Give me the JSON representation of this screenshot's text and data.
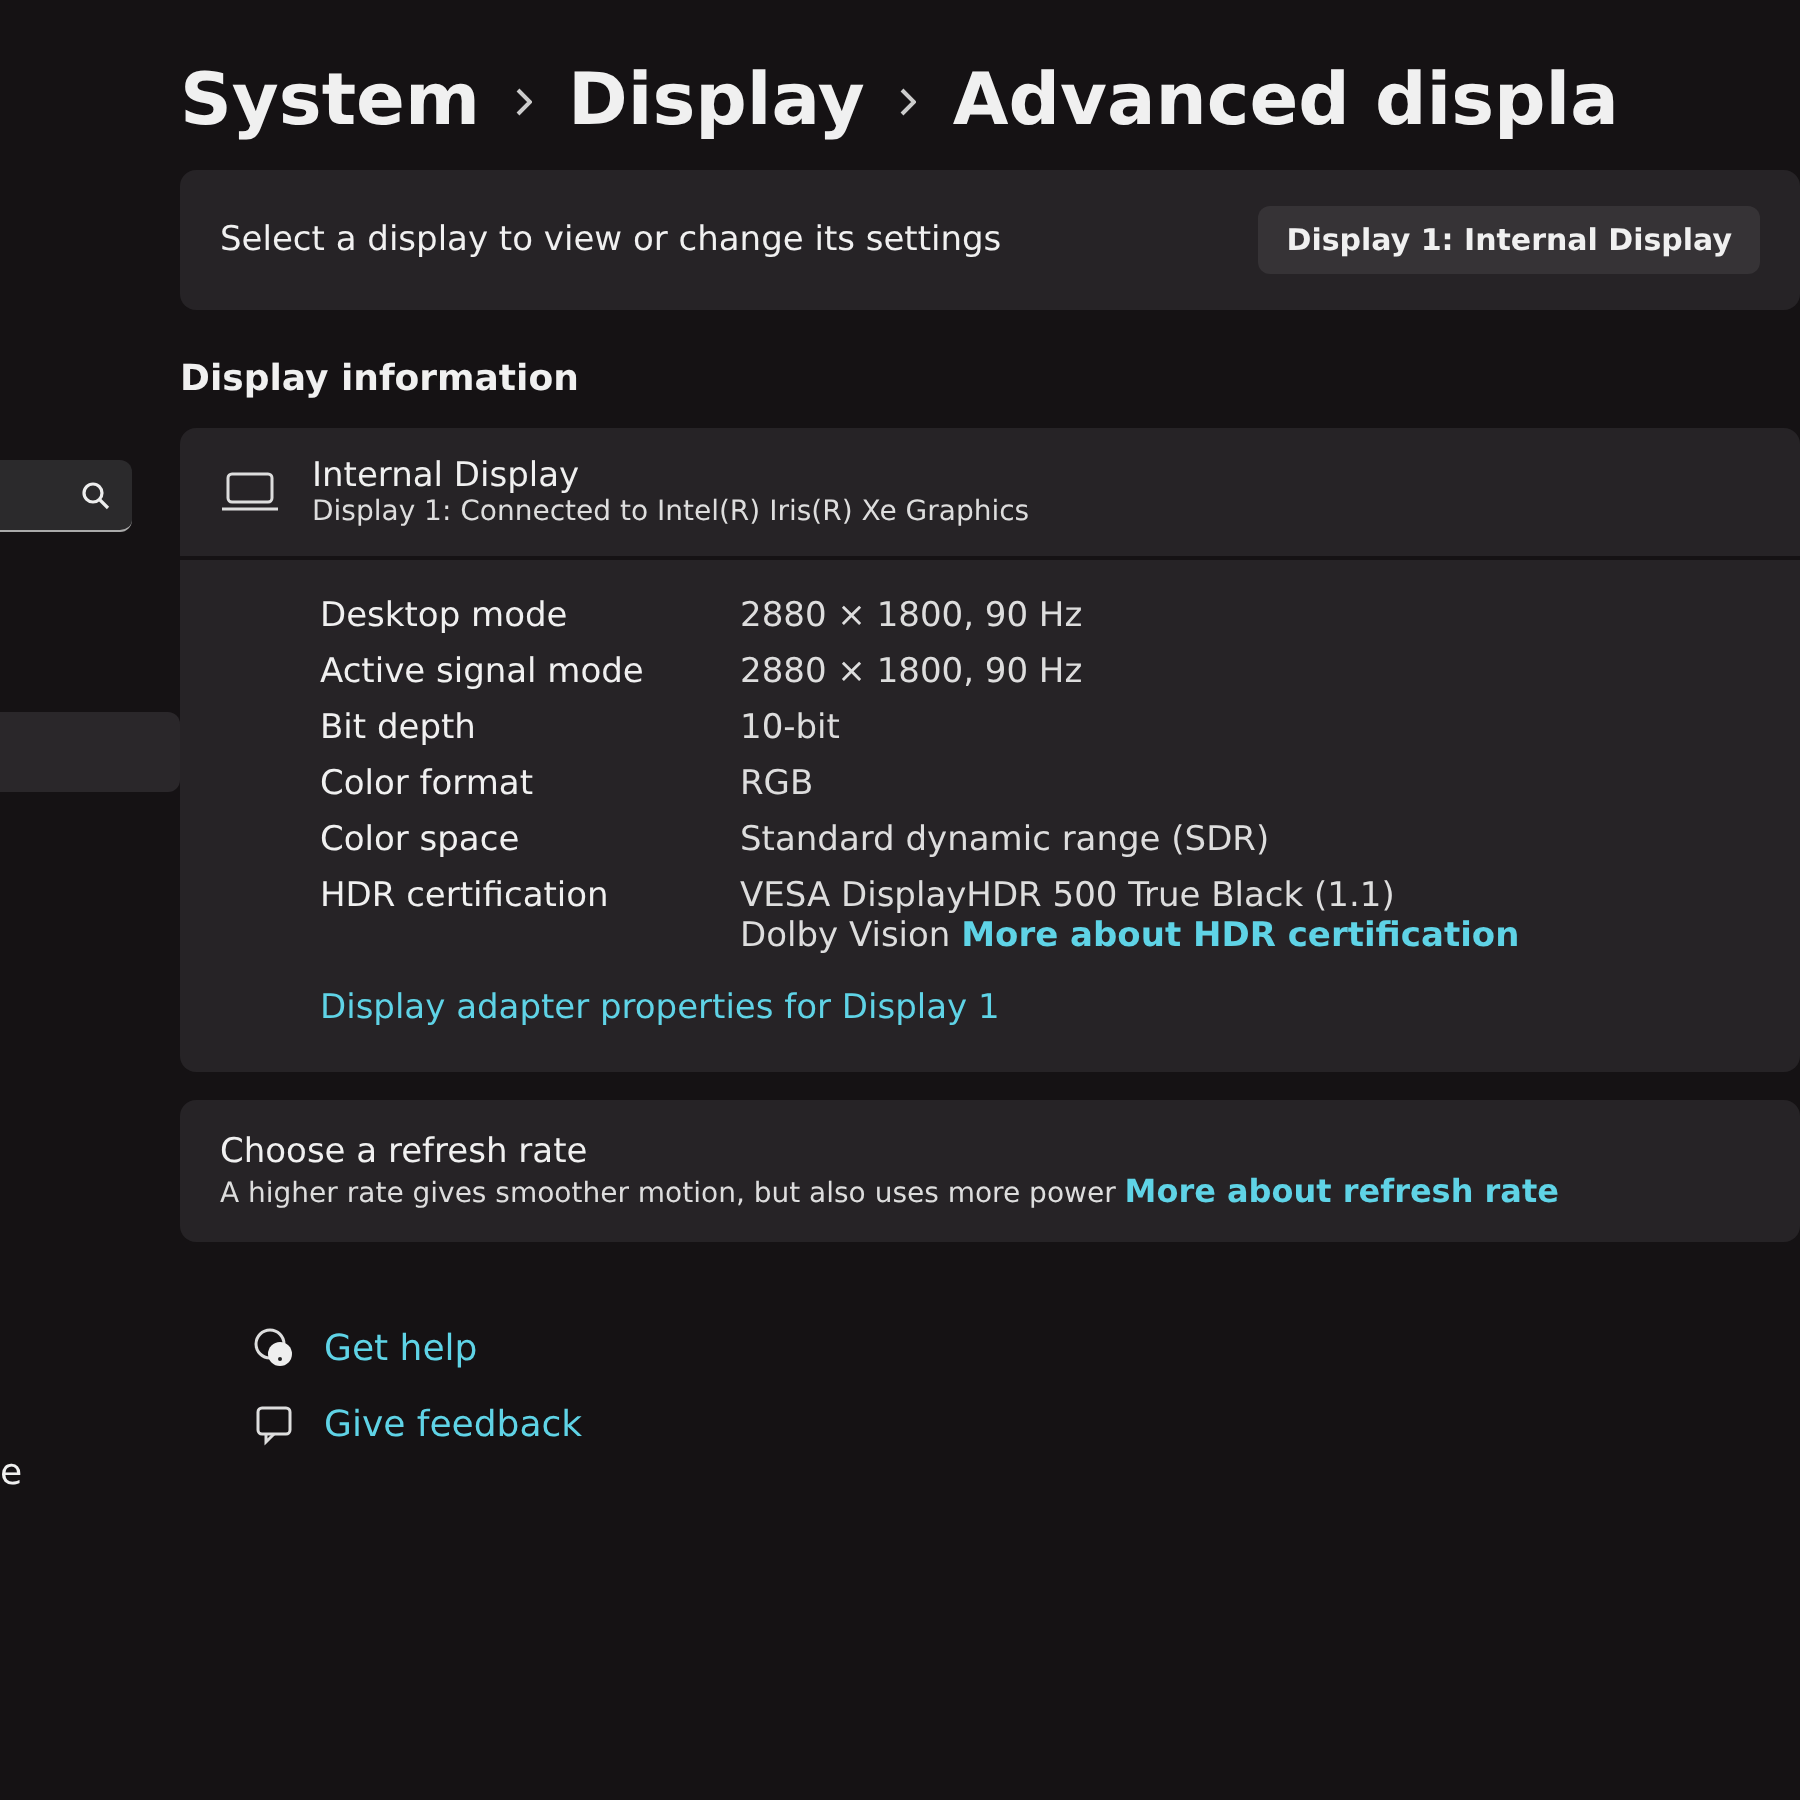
{
  "breadcrumb": [
    "System",
    "Display",
    "Advanced displa"
  ],
  "sidebar": {
    "items": [
      "e"
    ]
  },
  "display_select": {
    "label": "Select a display to view or change its settings",
    "value": "Display 1: Internal Display"
  },
  "display_information": {
    "heading": "Display information",
    "name": "Internal Display",
    "connection": "Display 1: Connected to Intel(R) Iris(R) Xe Graphics",
    "rows": [
      {
        "label": "Desktop mode",
        "value": "2880 × 1800, 90 Hz"
      },
      {
        "label": "Active signal mode",
        "value": "2880 × 1800, 90 Hz"
      },
      {
        "label": "Bit depth",
        "value": "10-bit"
      },
      {
        "label": "Color format",
        "value": "RGB"
      },
      {
        "label": "Color space",
        "value": "Standard dynamic range (SDR)"
      },
      {
        "label": "HDR certification",
        "value": "VESA DisplayHDR 500 True Black (1.1)",
        "value_2": "Dolby Vision",
        "link": "More about HDR certification"
      }
    ],
    "adapter_link": "Display adapter properties for Display 1"
  },
  "refresh_rate": {
    "title": "Choose a refresh rate",
    "description": "A higher rate gives smoother motion, but also uses more power",
    "link": "More about refresh rate"
  },
  "footer_links": [
    {
      "kind": "help",
      "label": "Get help"
    },
    {
      "kind": "feedback",
      "label": "Give feedback"
    }
  ]
}
